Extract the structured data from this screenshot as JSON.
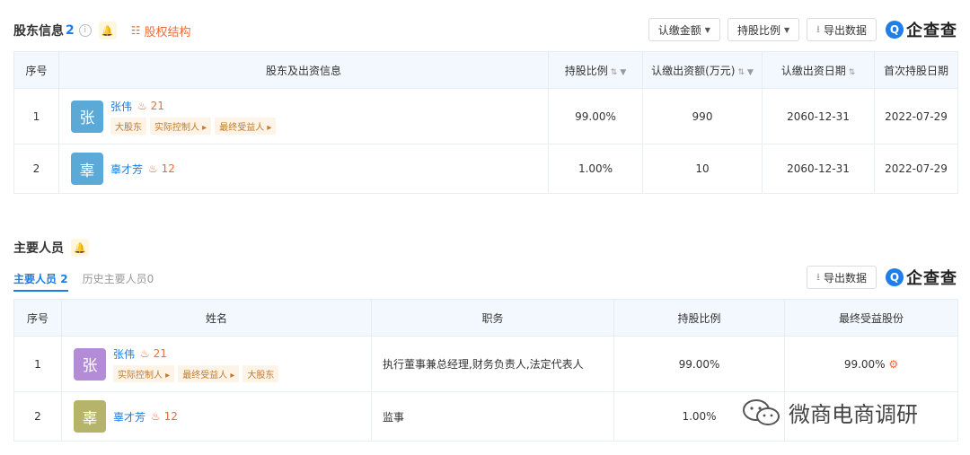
{
  "shareholders": {
    "title": "股东信息",
    "count": "2",
    "equity_link": "股权结构",
    "buttons": {
      "subscribed_amount": "认缴金额",
      "share_ratio": "持股比例",
      "export": "导出数据"
    },
    "logo_text": "企查查",
    "columns": [
      "序号",
      "股东及出资信息",
      "持股比例",
      "认缴出资额(万元)",
      "认缴出资日期",
      "首次持股日期"
    ],
    "rows": [
      {
        "no": "1",
        "avatar": "张",
        "name": "张伟",
        "rel": "21",
        "tags": [
          "大股东",
          "实际控制人",
          "最终受益人"
        ],
        "ratio": "99.00%",
        "amount": "990",
        "sub_date": "2060-12-31",
        "first_date": "2022-07-29"
      },
      {
        "no": "2",
        "avatar": "辜",
        "name": "辜才芳",
        "rel": "12",
        "tags": [],
        "ratio": "1.00%",
        "amount": "10",
        "sub_date": "2060-12-31",
        "first_date": "2022-07-29"
      }
    ]
  },
  "personnel": {
    "title": "主要人员",
    "tabs": {
      "current": "主要人员",
      "current_count": "2",
      "history": "历史主要人员0"
    },
    "export": "导出数据",
    "logo_text": "企查查",
    "columns": [
      "序号",
      "姓名",
      "职务",
      "持股比例",
      "最终受益股份"
    ],
    "rows": [
      {
        "no": "1",
        "avatar": "张",
        "name": "张伟",
        "rel": "21",
        "tags": [
          "实际控制人",
          "最终受益人",
          "大股东"
        ],
        "position": "执行董事兼总经理,财务负责人,法定代表人",
        "ratio": "99.00%",
        "benefit": "99.00%"
      },
      {
        "no": "2",
        "avatar": "辜",
        "name": "辜才芳",
        "rel": "12",
        "tags": [],
        "position": "监事",
        "ratio": "1.00%",
        "benefit": ""
      }
    ]
  },
  "watermark": "微商电商调研",
  "colors": {
    "accent": "#1b7ee8",
    "orange": "#f06a35",
    "avatar_blue": "#5ba9d6",
    "avatar_purple": "#b48bd6",
    "avatar_olive": "#b5b46a"
  }
}
